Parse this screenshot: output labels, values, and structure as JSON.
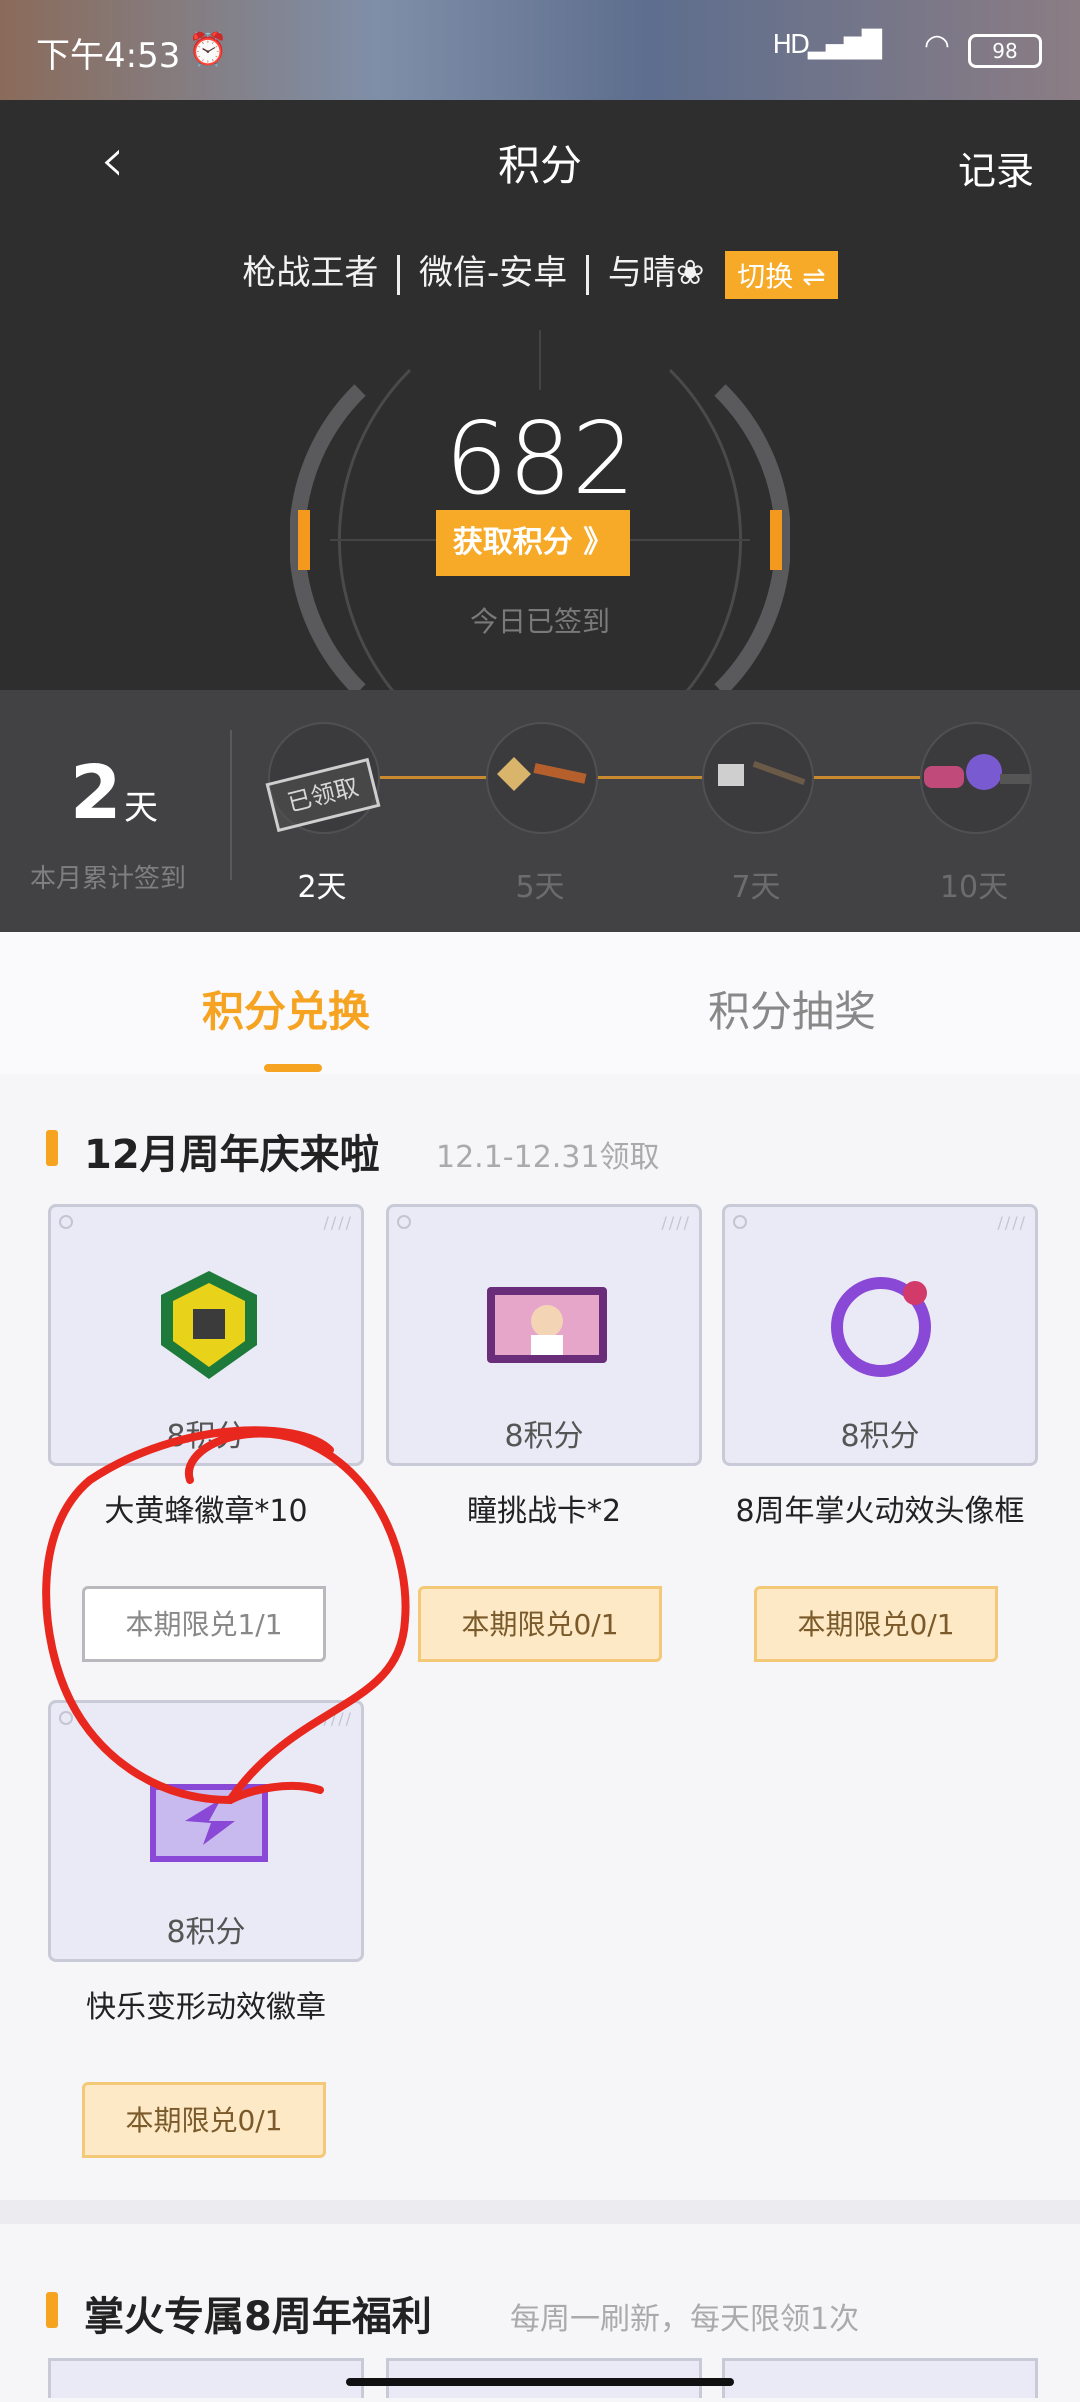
{
  "status_bar": {
    "time": "下午4:53",
    "battery": "98"
  },
  "header": {
    "title": "积分",
    "record_label": "记录",
    "account": {
      "game": "枪战王者",
      "platform": "微信-安卓",
      "player": "与晴❀",
      "switch_label": "切换 ⇌"
    },
    "score": "682",
    "earn_button": "获取积分 》",
    "signed_text": "今日已签到"
  },
  "sign_in": {
    "days": "2",
    "days_unit": "天",
    "days_label": "本月累计签到",
    "claimed_stamp": "已领取",
    "milestones": [
      {
        "label": "2天",
        "active": true
      },
      {
        "label": "5天",
        "active": false
      },
      {
        "label": "7天",
        "active": false
      },
      {
        "label": "10天",
        "active": false
      }
    ]
  },
  "tabs": [
    {
      "label": "积分兑换",
      "active": true
    },
    {
      "label": "积分抽奖",
      "active": false
    }
  ],
  "section1": {
    "title": "12月周年庆来啦",
    "subtitle": "12.1-12.31领取",
    "items": [
      {
        "points": "8积分",
        "name": "大黄蜂徽章*10",
        "limit": "本期限兑1/1",
        "state": "used",
        "icon": "bumblebee-badge-icon"
      },
      {
        "points": "8积分",
        "name": "瞳挑战卡*2",
        "limit": "本期限兑0/1",
        "state": "avail",
        "icon": "challenge-card-icon"
      },
      {
        "points": "8积分",
        "name": "8周年掌火动效头像框",
        "limit": "本期限兑0/1",
        "state": "avail",
        "icon": "avatar-frame-icon"
      },
      {
        "points": "8积分",
        "name": "快乐变形动效徽章",
        "limit": "本期限兑0/1",
        "state": "avail",
        "icon": "transform-badge-icon"
      }
    ]
  },
  "section2": {
    "title": "掌火专属8周年福利",
    "subtitle": "每周一刷新，每天限领1次"
  },
  "colors": {
    "accent": "#f5a321",
    "header_bg": "#2e2e2f",
    "annotation_red": "#e8281e"
  }
}
